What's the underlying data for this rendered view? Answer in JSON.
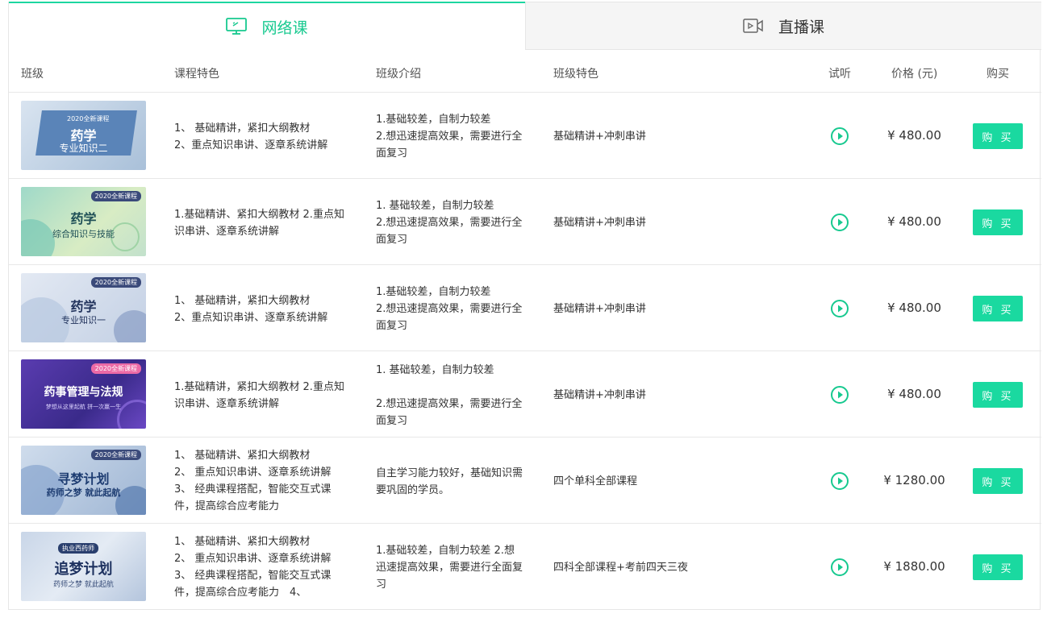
{
  "tabs": [
    {
      "label": "网络课",
      "icon": "monitor-icon",
      "active": true
    },
    {
      "label": "直播课",
      "icon": "video-icon",
      "active": false
    }
  ],
  "colors": {
    "accent": "#17c98f",
    "button": "#1ad9a0"
  },
  "headers": {
    "class": "班级",
    "course_feature": "课程特色",
    "class_intro": "班级介绍",
    "class_feature": "班级特色",
    "trial": "试听",
    "price": "价格 (元)",
    "buy": "购买"
  },
  "rows": [
    {
      "thumb": {
        "badge": "2020全新课程",
        "title": "药学",
        "subtitle": "专业知识二"
      },
      "feature": "1、 基础精讲，紧扣大纲教材\n 2、重点知识串讲、逐章系统讲解",
      "intro": "1.基础较差，自制力较差\n 2.想迅速提高效果，需要进行全面复习",
      "special": "基础精讲+冲刺串讲",
      "price": "¥ 480.00",
      "buy": "购 买"
    },
    {
      "thumb": {
        "badge": "2020全新课程",
        "title": "药学",
        "subtitle": "综合知识与技能"
      },
      "feature": "1.基础精讲、紧扣大纲教材 2.重点知识串讲、逐章系统讲解",
      "intro": "1. 基础较差，自制力较差\n 2.想迅速提高效果，需要进行全面复习",
      "special": "基础精讲+冲刺串讲",
      "price": "¥ 480.00",
      "buy": "购 买"
    },
    {
      "thumb": {
        "badge": "2020全新课程",
        "title": "药学",
        "subtitle": "专业知识一"
      },
      "feature": "1、 基础精讲，紧扣大纲教材\n2、重点知识串讲、逐章系统讲解",
      "intro": "1.基础较差，自制力较差\n2.想迅速提高效果，需要进行全面复习",
      "special": "基础精讲+冲刺串讲",
      "price": "¥ 480.00",
      "buy": "购 买"
    },
    {
      "thumb": {
        "badge": "2020全新课程",
        "title": "药事管理与法规",
        "subtitle": "梦想从这里起航 拼一次赢一生"
      },
      "feature": "1.基础精讲，紧扣大纲教材 2.重点知识串讲、逐章系统讲解",
      "intro": "1. 基础较差，自制力较差\n\n2.想迅速提高效果，需要进行全面复习",
      "special": "基础精讲+冲刺串讲",
      "price": "¥ 480.00",
      "buy": "购 买"
    },
    {
      "thumb": {
        "badge": "2020全新课程",
        "title": "寻梦计划",
        "subtitle": "药师之梦 就此起航"
      },
      "feature": "1、 基础精讲、紧扣大纲教材\n2、 重点知识串讲、逐章系统讲解\n3、 经典课程搭配，智能交互式课件，提高综合应考能力",
      "intro": "自主学习能力较好，基础知识需要巩固的学员。",
      "special": "四个单科全部课程",
      "price": "¥ 1280.00",
      "buy": "购 买"
    },
    {
      "thumb": {
        "badge": "执业西药师",
        "title": "追梦计划",
        "subtitle": "药师之梦 就此起航"
      },
      "feature": "1、 基础精讲、紧扣大纲教材\n2、 重点知识串讲、逐章系统讲解　3、 经典课程搭配，智能交互式课件，提高综合应考能力　4、",
      "intro": "1.基础较差，自制力较差 2.想迅速提高效果，需要进行全面复习",
      "special": "四科全部课程+考前四天三夜",
      "price": "¥ 1880.00",
      "buy": "购 买"
    }
  ]
}
